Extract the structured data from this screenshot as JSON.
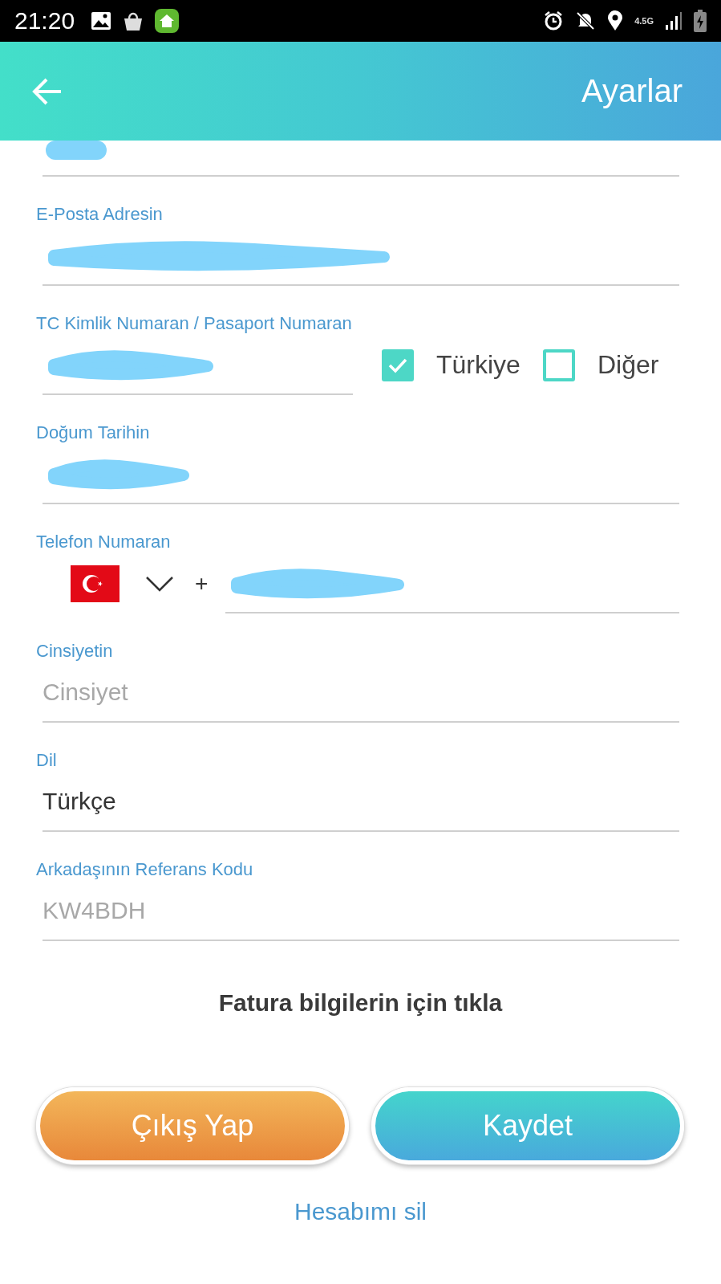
{
  "status_bar": {
    "time": "21:20",
    "network": "4.5G"
  },
  "header": {
    "title": "Ayarlar"
  },
  "fields": [
    {
      "kind": "partial"
    },
    {
      "kind": "redacted",
      "label": "E-Posta Adresin"
    },
    {
      "kind": "id",
      "label": "TC Kimlik Numaran / Pasaport Numaran",
      "options": [
        {
          "label": "Türkiye",
          "checked": true
        },
        {
          "label": "Diğer",
          "checked": false
        }
      ]
    },
    {
      "kind": "redacted",
      "label": "Doğum Tarihin"
    },
    {
      "kind": "phone",
      "label": "Telefon Numaran",
      "prefix": "+"
    },
    {
      "kind": "select",
      "label": "Cinsiyetin",
      "placeholder": "Cinsiyet"
    },
    {
      "kind": "select",
      "label": "Dil",
      "value": "Türkçe"
    },
    {
      "kind": "text",
      "label": "Arkadaşının Referans Kodu",
      "placeholder": "KW4BDH"
    }
  ],
  "billing_link": "Fatura bilgilerin için tıkla",
  "buttons": [
    {
      "kind": "logout",
      "label": "Çıkış Yap"
    },
    {
      "kind": "save",
      "label": "Kaydet"
    }
  ],
  "delete_link": "Hesabımı sil"
}
